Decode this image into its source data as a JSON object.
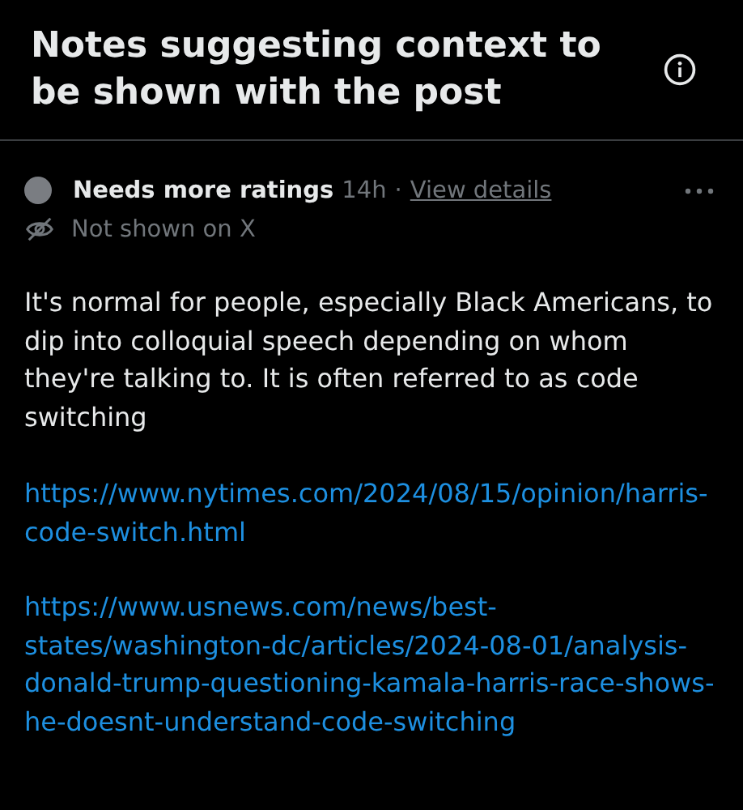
{
  "header": {
    "title": "Notes suggesting context to be shown with the post"
  },
  "note": {
    "status": "Needs more ratings",
    "time": "14h",
    "separator": "·",
    "details_link": "View details",
    "visibility": "Not shown on X",
    "body": "It's normal for people, especially Black Americans, to dip into colloquial speech depending on whom they're talking to. It is often referred to as code switching",
    "links": [
      "https://www.nytimes.com/2024/08/15/opinion/harris-code-switch.html",
      "https://www.usnews.com/news/best-states/washington-dc/articles/2024-08-01/analysis-donald-trump-questioning-kamala-harris-race-shows-he-doesnt-understand-code-switching"
    ]
  }
}
